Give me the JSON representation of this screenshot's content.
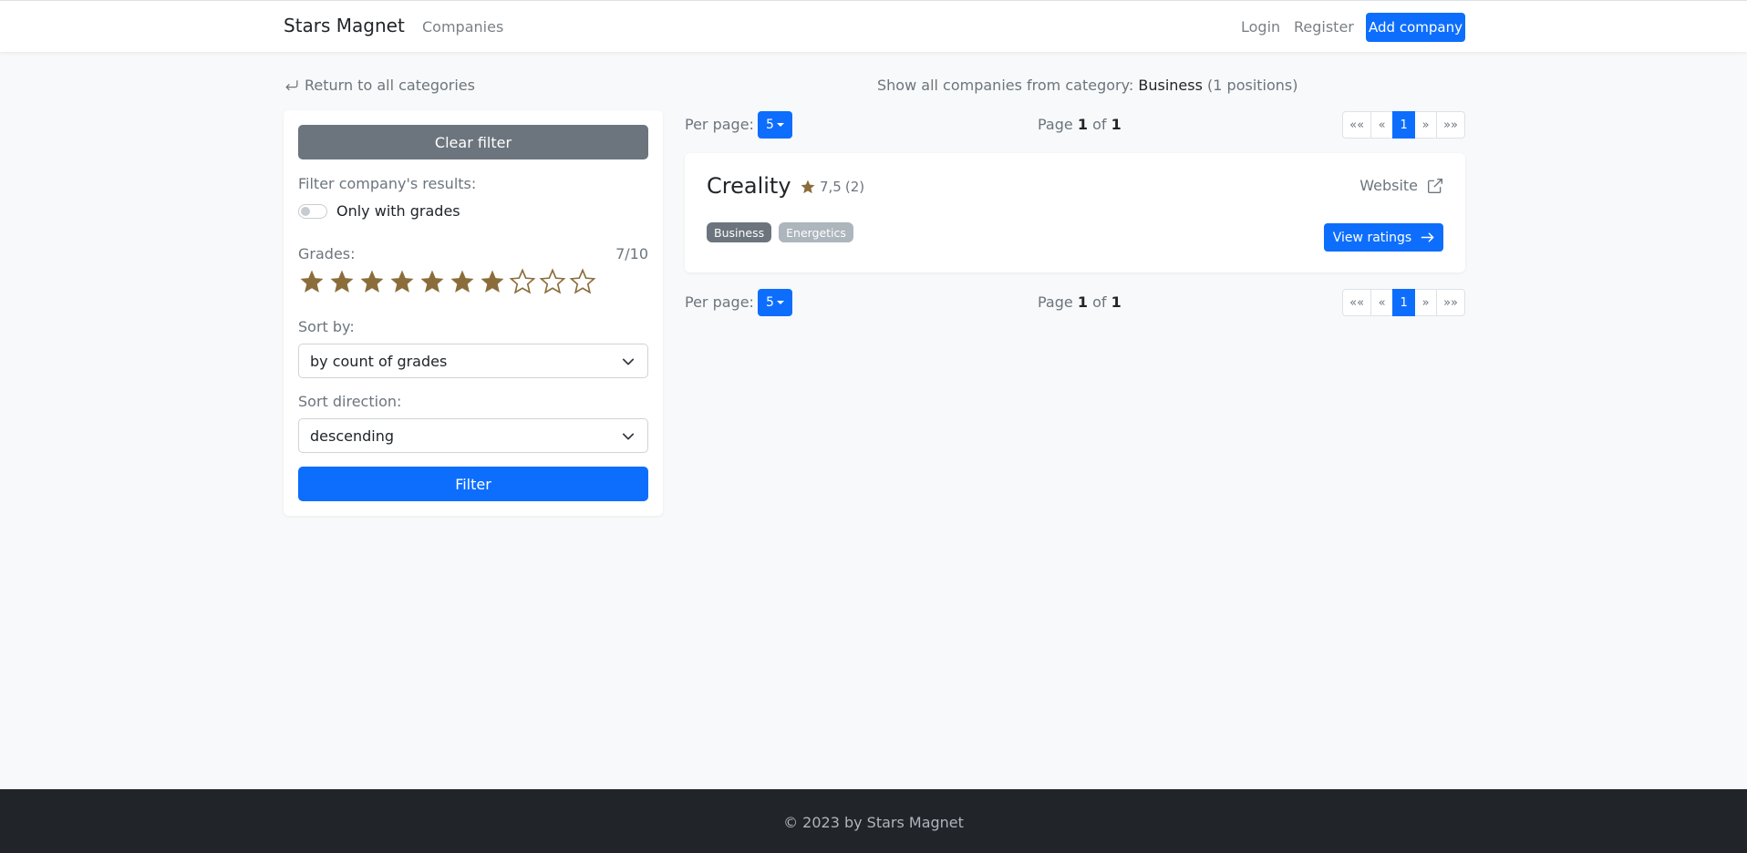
{
  "navbar": {
    "brand": "Stars Magnet",
    "companies_link": "Companies",
    "login_link": "Login",
    "register_link": "Register",
    "add_company_button": "Add company"
  },
  "header": {
    "return_link": "Return to all categories",
    "category_prefix": "Show all companies from category:",
    "category_name": "Business",
    "category_count": "(1 positions)"
  },
  "filter": {
    "clear_button": "Clear filter",
    "filter_label": "Filter company's results:",
    "only_with_grades_label": "Only with grades",
    "only_with_grades_checked": false,
    "grades_label": "Grades:",
    "grades_value": "7/10",
    "grades_selected": 7,
    "grades_max": 10,
    "star_color": "#8a6d3b",
    "sort_by_label": "Sort by:",
    "sort_by_value": "by count of grades",
    "sort_direction_label": "Sort direction:",
    "sort_direction_value": "descending",
    "filter_button": "Filter"
  },
  "pagination": {
    "per_page_label": "Per page:",
    "per_page_value": "5",
    "page_word": "Page",
    "of_word": "of",
    "current_page": "1",
    "total_pages": "1",
    "first": "««",
    "prev": "«",
    "next": "»",
    "last": "»»"
  },
  "companies": [
    {
      "name": "Creality",
      "rating": "7,5",
      "rating_count": "(2)",
      "website_label": "Website",
      "badges": [
        "Business",
        "Energetics"
      ],
      "view_button": "View ratings"
    }
  ],
  "footer": {
    "text": "© 2023 by Stars Magnet"
  },
  "colors": {
    "primary": "#0d6efd",
    "secondary": "#6c757d",
    "footer_bg": "#212529"
  }
}
